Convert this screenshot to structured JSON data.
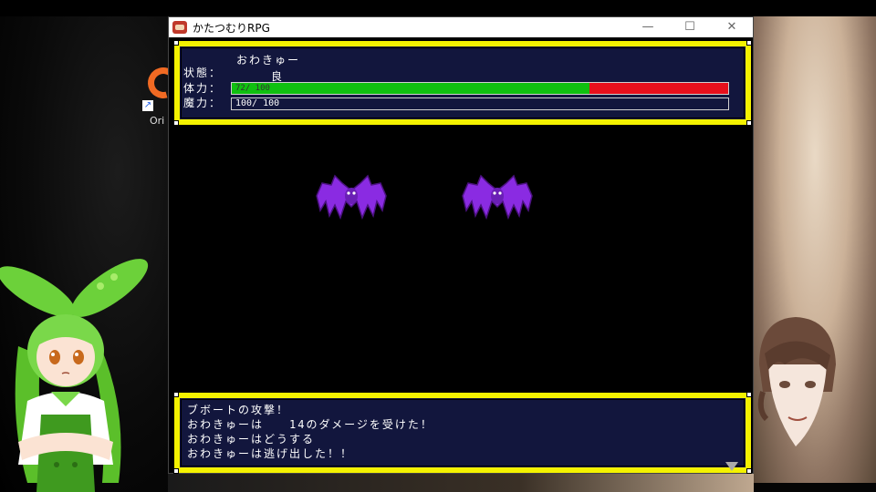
{
  "desktop": {
    "icon_label": "Ori"
  },
  "window": {
    "title": "かたつむりRPG",
    "minimize": "—",
    "maximize": "☐",
    "close": "✕"
  },
  "status": {
    "name": "おわきゅー",
    "condition_label": "状態：",
    "condition_value": "良",
    "hp_label": "体力：",
    "hp_text": "72/ 100",
    "hp_fraction": 0.72,
    "mp_label": "魔力：",
    "mp_text": "100/ 100"
  },
  "battle": {
    "enemy_color": "#8a2be2",
    "enemies": [
      "bat-enemy",
      "bat-enemy"
    ]
  },
  "messages": [
    "ブボートの攻撃！",
    "おわきゅーは　　14のダメージを受けた！",
    "おわきゅーはどうする",
    "おわきゅーは逃げ出した！！"
  ],
  "colors": {
    "frame": "#f4f200",
    "panel": "#12163d",
    "hp_green": "#10c010",
    "hp_red": "#e8101c"
  }
}
